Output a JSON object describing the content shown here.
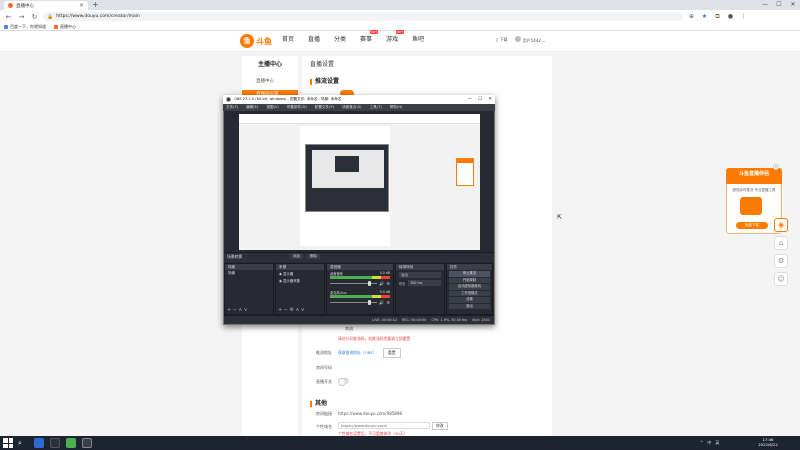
{
  "browser": {
    "tab_title": "直播中心",
    "url": "https://www.douyu.com/creator/main",
    "bookmarks": [
      "百度一下，你就知道",
      "直播中心"
    ]
  },
  "site": {
    "logo_text": "斗鱼",
    "nav": [
      "首页",
      "直播",
      "分类",
      "赛事",
      "游戏",
      "鱼吧"
    ],
    "hot_badge": "HOT",
    "user_items": [
      "下载",
      "用户5442"
    ]
  },
  "left_panel": {
    "title": "主播中心",
    "items": [
      "直播中心",
      "直播间设置"
    ]
  },
  "main_panel": {
    "head": "直播设置",
    "section_title": "推流设置",
    "warning1": "推流设置，请勿透露给他人使用",
    "stream_label": "串流",
    "warning2": "请勿公开推流码，若推流码泄露请立即重置",
    "push_label": "推流地址",
    "push_link": "获取推流地址（OBS）",
    "reset_button": "重置",
    "room_label": "房间号码",
    "auto_label": "直播开关",
    "other_title": "其他",
    "room_link_label": "房间链接",
    "room_link": "https://www.douyu.com/985898",
    "custom_label": "个性域名",
    "custom_value": "https://www.douyu.com/",
    "custom_button": "修改",
    "custom_hint": "个性域名设置后，不可重复修改（30天）"
  },
  "promo": {
    "title": "斗鱼直播伴侣",
    "subtitle": "超低延时推流·专业直播工具",
    "button": "免费下载"
  },
  "obs": {
    "title": "OBS 27.2.0 (64-bit, windows) - 配置文件: 未命名 - 场景: 未命名",
    "menu": [
      "文件(F)",
      "编辑(E)",
      "视图(V)",
      "停靠部件(D)",
      "配置文件(P)",
      "场景集合(S)",
      "工具(T)",
      "帮助(H)"
    ],
    "scene_header": "场景转换",
    "trans_buttons": [
      "添加",
      "删除"
    ],
    "docks": {
      "scenes": {
        "title": "场景",
        "items": [
          "场景"
        ]
      },
      "sources": {
        "title": "来源",
        "items": [
          "显示器",
          "显示器采集"
        ]
      },
      "mixer": {
        "title": "混音器",
        "ch1": "桌面音频",
        "ch1_val": "0.0 dB",
        "ch2": "麦克风/Aux",
        "ch2_val": "0.0 dB"
      },
      "transitions": {
        "title": "转场特效",
        "type": "淡出",
        "duration_label": "时长",
        "duration": "300 ms"
      },
      "controls": {
        "title": "控件",
        "buttons": [
          "停止推流",
          "开始录制",
          "启动虚拟摄像机",
          "工作室模式",
          "设置",
          "退出"
        ]
      }
    },
    "status": [
      "LIVE: 00:00:12",
      "REC: 00:00:00",
      "CPU: 1.9%, 30.00 fps",
      "kb/s: 2501"
    ]
  },
  "taskbar": {
    "time": "17:46",
    "date": "2022/6/22",
    "tray": [
      "^",
      "中",
      "英"
    ]
  },
  "colors": {
    "brand": "#ff7a00",
    "obs_bg": "#272a33",
    "warn": "#e64545",
    "link": "#2f80ed"
  }
}
